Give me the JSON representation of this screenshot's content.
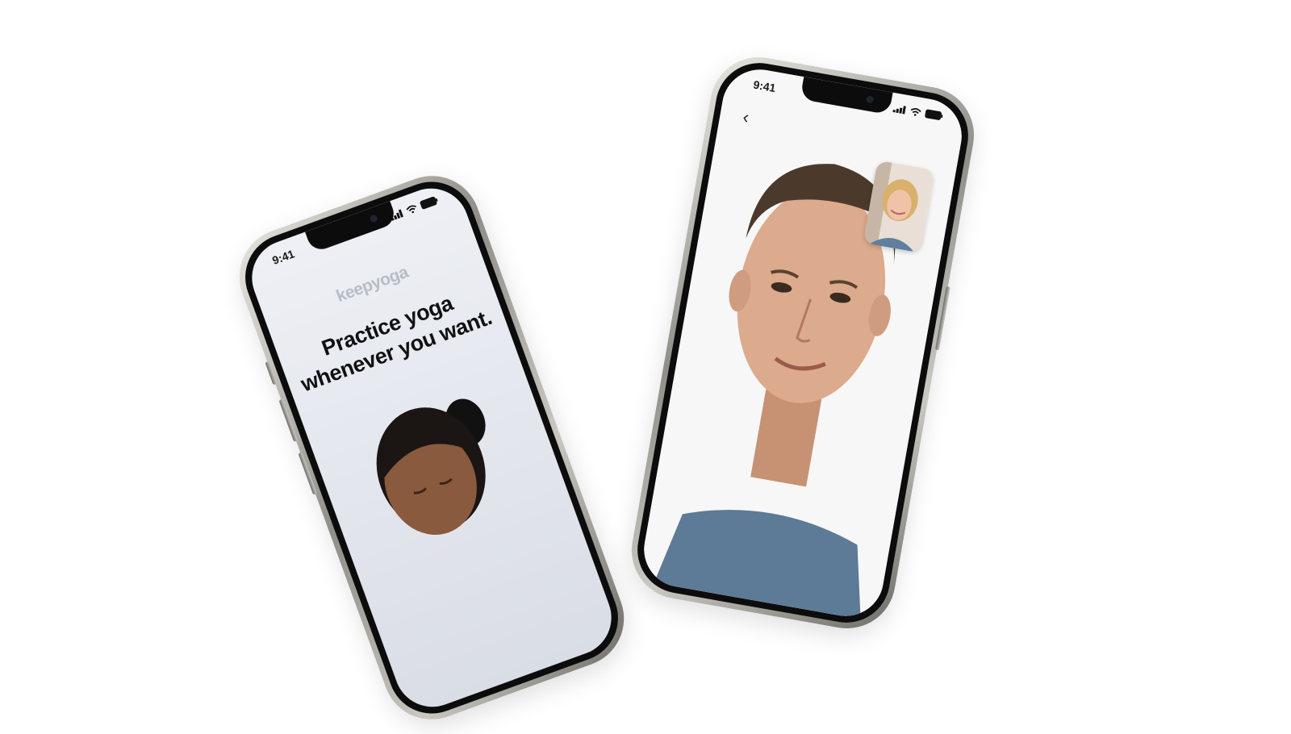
{
  "phone_left": {
    "status": {
      "time": "9:41"
    },
    "logo": "keepyoga",
    "headline_line1": "Practice yoga",
    "headline_line2": "whenever you want."
  },
  "phone_right": {
    "status": {
      "time": "9:41"
    },
    "back_icon": "chevron-left-icon",
    "pip_caller": "video-call-pip"
  },
  "colors": {
    "frame": "#8f8e88",
    "screen_bg_left": "#e4e7ee",
    "headline": "#111111",
    "logo": "#b8bcc6"
  }
}
